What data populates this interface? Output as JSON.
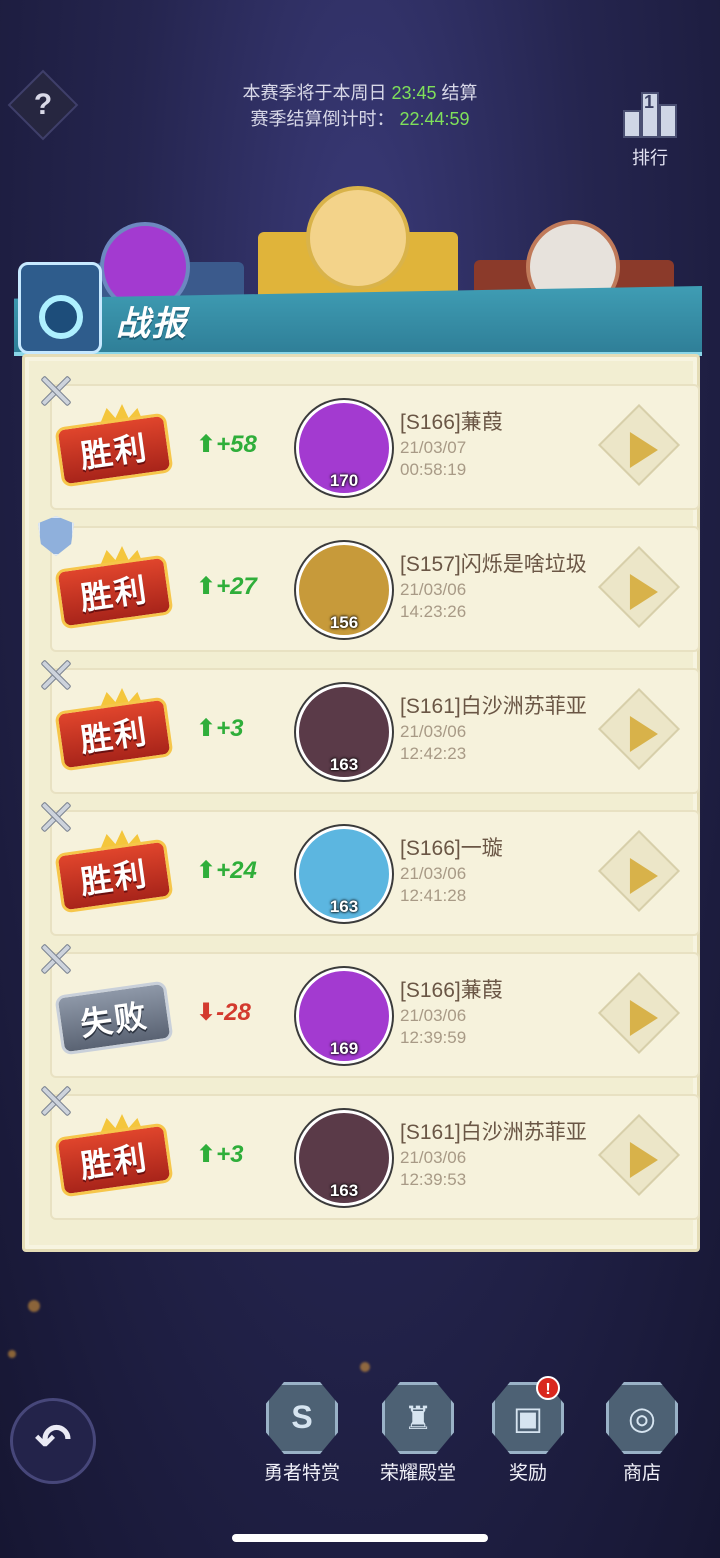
{
  "header": {
    "help_label": "?",
    "season_line1_prefix": "本赛季将于本周日",
    "season_line1_time": "23:45",
    "season_line1_suffix": "结算",
    "season_line2_prefix": "赛季结算倒计时：",
    "season_line2_countdown": "22:44:59",
    "rank_number": "1",
    "rank_label": "排行"
  },
  "panel": {
    "title": "战报"
  },
  "battles": [
    {
      "type_icon": "swords-icon",
      "result": "胜利",
      "result_kind": "win",
      "delta": "+58",
      "delta_kind": "up",
      "level": "170",
      "name": "[S166]蒹葭",
      "date": "21/03/07",
      "time": "00:58:19",
      "avatar_color": "#a33ad0"
    },
    {
      "type_icon": "shield-icon",
      "result": "胜利",
      "result_kind": "win",
      "delta": "+27",
      "delta_kind": "up",
      "level": "156",
      "name": "[S157]闪烁是啥垃圾",
      "date": "21/03/06",
      "time": "14:23:26",
      "avatar_color": "#c79a3a"
    },
    {
      "type_icon": "swords-icon",
      "result": "胜利",
      "result_kind": "win",
      "delta": "+3",
      "delta_kind": "up",
      "level": "163",
      "name": "[S161]白沙洲苏菲亚",
      "date": "21/03/06",
      "time": "12:42:23",
      "avatar_color": "#5a3a48"
    },
    {
      "type_icon": "swords-icon",
      "result": "胜利",
      "result_kind": "win",
      "delta": "+24",
      "delta_kind": "up",
      "level": "163",
      "name": "[S166]一璇",
      "date": "21/03/06",
      "time": "12:41:28",
      "avatar_color": "#5cb6e0"
    },
    {
      "type_icon": "swords-icon",
      "result": "失败",
      "result_kind": "lose",
      "delta": "-28",
      "delta_kind": "down",
      "level": "169",
      "name": "[S166]蒹葭",
      "date": "21/03/06",
      "time": "12:39:59",
      "avatar_color": "#a33ad0"
    },
    {
      "type_icon": "swords-icon",
      "result": "胜利",
      "result_kind": "win",
      "delta": "+3",
      "delta_kind": "up",
      "level": "163",
      "name": "[S161]白沙洲苏菲亚",
      "date": "21/03/06",
      "time": "12:39:53",
      "avatar_color": "#5a3a48"
    }
  ],
  "nav": {
    "back_label": "↶",
    "items": [
      {
        "label": "勇者特赏",
        "icon": "hero-reward-icon",
        "glyph": "S"
      },
      {
        "label": "荣耀殿堂",
        "icon": "hall-of-glory-icon",
        "glyph": "♜"
      },
      {
        "label": "奖励",
        "icon": "gift-icon",
        "glyph": "▣",
        "alert": "!"
      },
      {
        "label": "商店",
        "icon": "shop-icon",
        "glyph": "◎"
      }
    ]
  },
  "colors": {
    "accent_green": "#7fe05a",
    "win_red": "#d33a2e",
    "panel_bg": "#f2eed2"
  }
}
